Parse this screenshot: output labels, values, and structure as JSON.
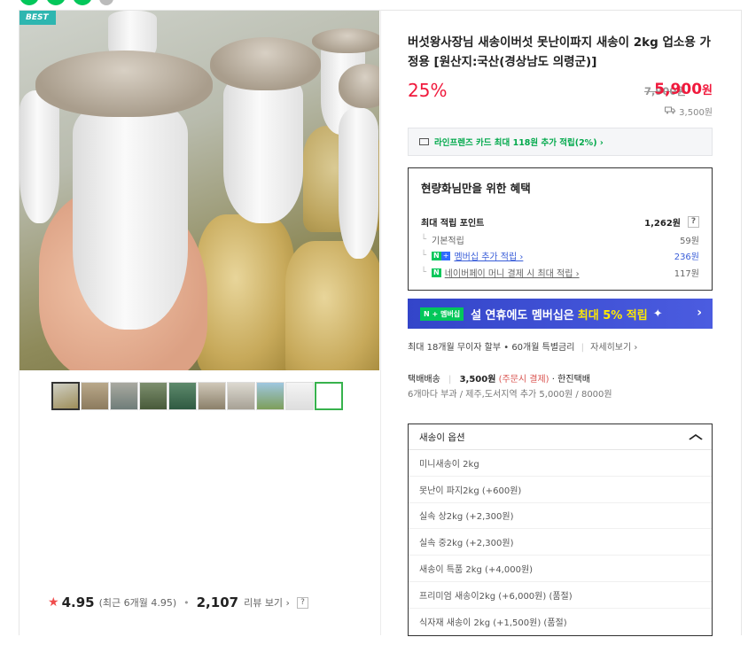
{
  "badge": "BEST",
  "product": {
    "title": "버섯왕사장님 새송이버섯 못난이파지 새송이 2kg 업소용 가정용 [원산지:국산(경상남도 의령군)]",
    "discount": "25%",
    "original_price": "7,900원",
    "price": "5,900",
    "price_unit": "원",
    "shipping_fee": "3,500원"
  },
  "card": {
    "text": "라인프렌즈 카드 최대 118원 추가 적립(2%) ›"
  },
  "benefit": {
    "title": "현량화님만을 위한 혜택",
    "max_points_label": "최대 적립 포인트",
    "max_points_value": "1,262원",
    "rows": [
      {
        "label": "기본적립",
        "value": "59원"
      },
      {
        "label": "멤버십 추가 적립 ›",
        "value": "236원"
      },
      {
        "label": "네이버페이 머니 결제 시 최대 적립 ›",
        "value": "117원"
      }
    ]
  },
  "banner": {
    "badge": "N + 멤버십",
    "text": "설 연휴에도 멤버십은",
    "highlight": "최대 5% 적립",
    "arrow": "›"
  },
  "installment": {
    "text": "최대 18개월 무이자 할부 • 60개월 특별금리",
    "more": "자세히보기 ›"
  },
  "delivery": {
    "label": "택배배송",
    "fee": "3,500원",
    "note": "(주문시 결제)",
    "carrier": "· 한진택배",
    "extra": "6개마다 부과 / 제주,도서지역 추가 5,000원 / 8000원"
  },
  "select": {
    "label": "새송이 옵션",
    "options": [
      "미니새송이 2kg",
      "못난이 파지2kg (+600원)",
      "실속 상2kg (+2,300원)",
      "실속 중2kg (+2,300원)",
      "새송이 특품 2kg (+4,000원)",
      "프리미엄 새송이2kg (+6,000원) (품절)",
      "식자재 새송이 2kg (+1,500원) (품절)"
    ]
  },
  "rating": {
    "score": "4.95",
    "recent": "(최근 6개월 4.95)",
    "reviews": "2,107",
    "reviews_label": "리뷰 보기 ›",
    "help": "?"
  },
  "help_icon": "?",
  "icons": [
    "star-icon",
    "truck-icon",
    "card-icon",
    "chevron-up-icon",
    "help-icon"
  ],
  "colors": {
    "accent": "#f0193c",
    "naver_green": "#03c75a",
    "banner_blue": "#3345c9",
    "best_teal": "#2eb6b0",
    "link_blue": "#3a5ed8"
  }
}
